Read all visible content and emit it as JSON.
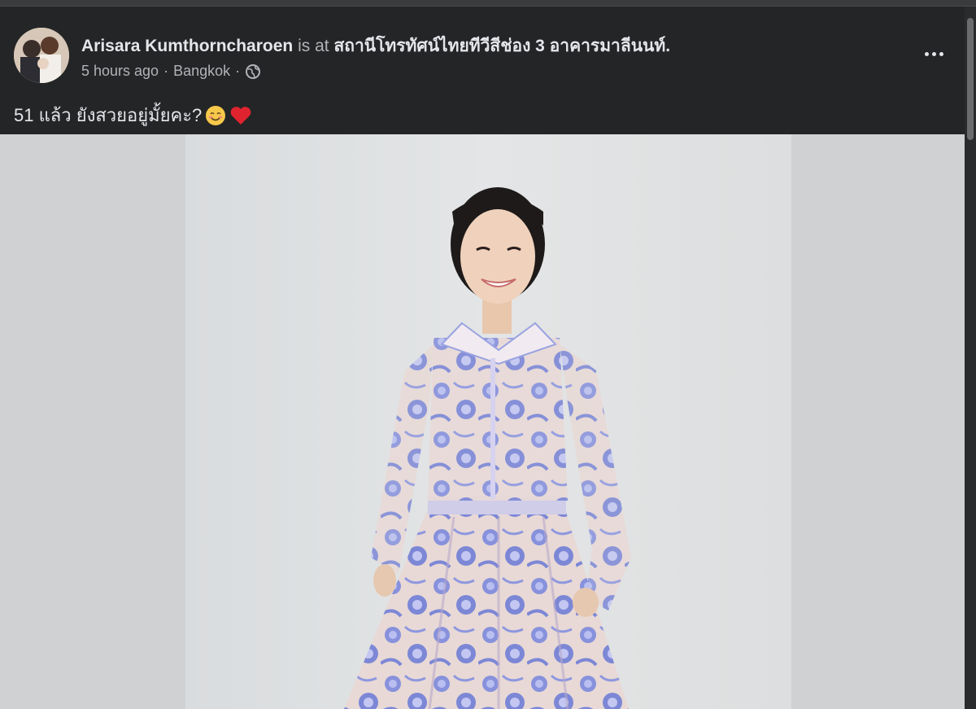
{
  "post": {
    "author": "Arisara Kumthorncharoen",
    "is_at": "is at",
    "location": "สถานีโทรทัศน์ไทยทีวีสีช่อง 3 อาคารมาลีนนท์.",
    "time": "5 hours ago",
    "separator": "·",
    "place": "Bangkok",
    "privacy_icon": "globe-icon",
    "caption": "51 แล้ว ยังสวยอยู่มั้ยคะ?",
    "caption_emojis": [
      "smiling-face-icon",
      "red-heart-icon"
    ]
  },
  "photo": {
    "subject": "woman-in-blue-floral-dress"
  },
  "colors": {
    "background": "#242526",
    "text_primary": "#e4e6eb",
    "text_secondary": "#b0b3b8",
    "dress_blue": "#7a86d8",
    "dress_base": "#e9dcd6"
  }
}
